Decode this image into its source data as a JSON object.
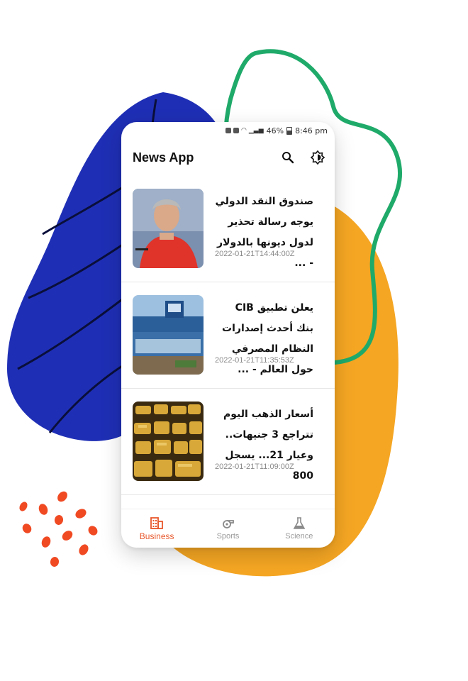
{
  "status_bar": {
    "battery": "46%",
    "time": "8:46 pm"
  },
  "app_bar": {
    "title": "News App",
    "search_icon": "search-icon",
    "theme_icon": "brightness-icon"
  },
  "articles": [
    {
      "headline": "صندوق النقد الدولي يوجه رسالة تحذير لدول ديونها بالدولار - ...",
      "date": "2022-01-21T14:44:00Z"
    },
    {
      "headline": "يعلن تطبيق CIB بنك أحدث إصدارات النظام المصرفي حول العالم - ...",
      "date": "2022-01-21T11:35:53Z"
    },
    {
      "headline": "أسعار الذهب اليوم تتراجع 3 جنيهات.. وعيار 21... يسجل 800",
      "date": "2022-01-21T11:09:00Z"
    }
  ],
  "bottom_nav": [
    {
      "label": "Business",
      "icon": "business-icon",
      "active": true
    },
    {
      "label": "Sports",
      "icon": "sports-icon",
      "active": false
    },
    {
      "label": "Science",
      "icon": "science-icon",
      "active": false
    }
  ],
  "colors": {
    "accent": "#e8572b",
    "blob_blue": "#1f2fb5",
    "blob_orange": "#f5a623",
    "blob_green": "#1faa6a",
    "dots": "#f04a23"
  }
}
